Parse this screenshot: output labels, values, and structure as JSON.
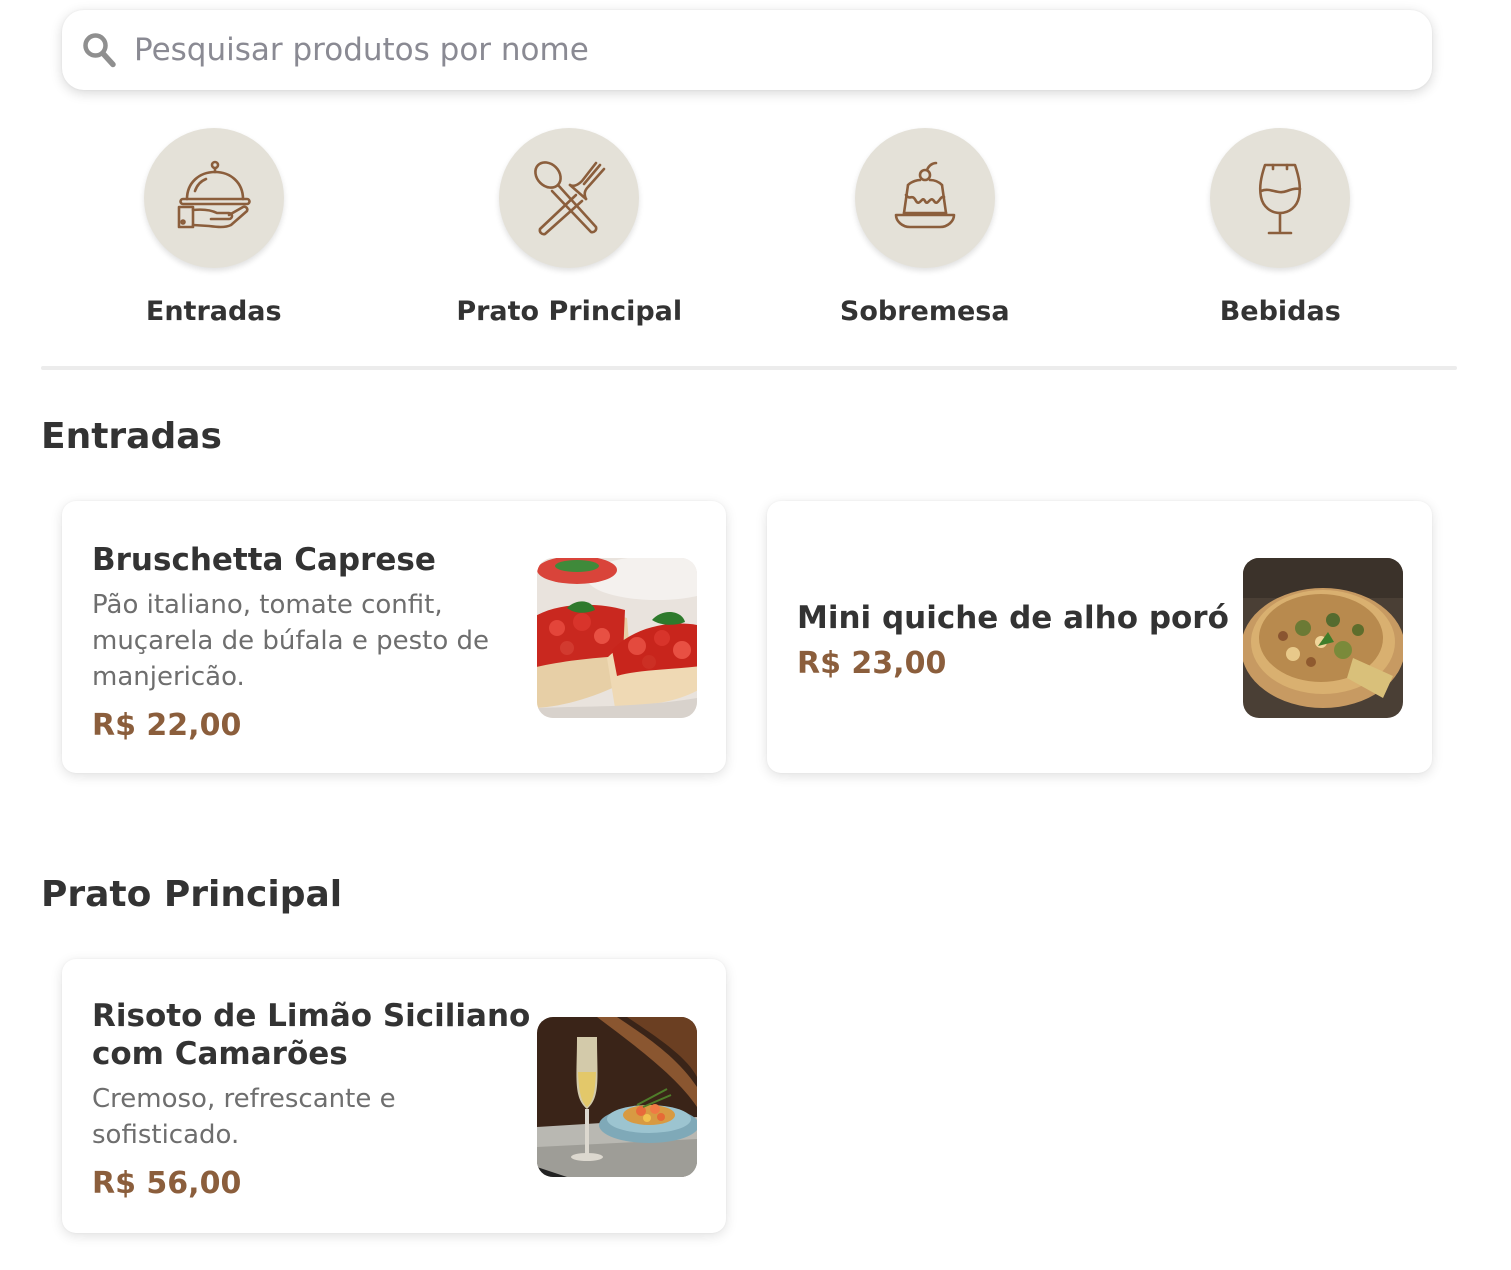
{
  "search": {
    "placeholder": "Pesquisar produtos por nome"
  },
  "categories": [
    {
      "label": "Entradas",
      "icon": "serving-cloche-icon"
    },
    {
      "label": "Prato Principal",
      "icon": "spoon-fork-icon"
    },
    {
      "label": "Sobremesa",
      "icon": "pudding-icon"
    },
    {
      "label": "Bebidas",
      "icon": "wine-glass-icon"
    }
  ],
  "sections": [
    {
      "title": "Entradas",
      "products": [
        {
          "name": "Bruschetta Caprese",
          "description": "Pão italiano, tomate confit, muçarela de búfala e pesto de manjericão.",
          "price": "R$ 22,00"
        },
        {
          "name": "Mini quiche de alho poró",
          "description": "",
          "price": "R$ 23,00"
        }
      ]
    },
    {
      "title": "Prato Principal",
      "products": [
        {
          "name": "Risoto de Limão Siciliano com Camarões",
          "description": "Cremoso, refrescante e sofisticado.",
          "price": "R$ 56,00"
        }
      ]
    }
  ],
  "colors": {
    "accent": "#8b5e3c",
    "category_bg": "#e4e1d8",
    "text": "#333333",
    "muted": "#6e6e6e"
  }
}
